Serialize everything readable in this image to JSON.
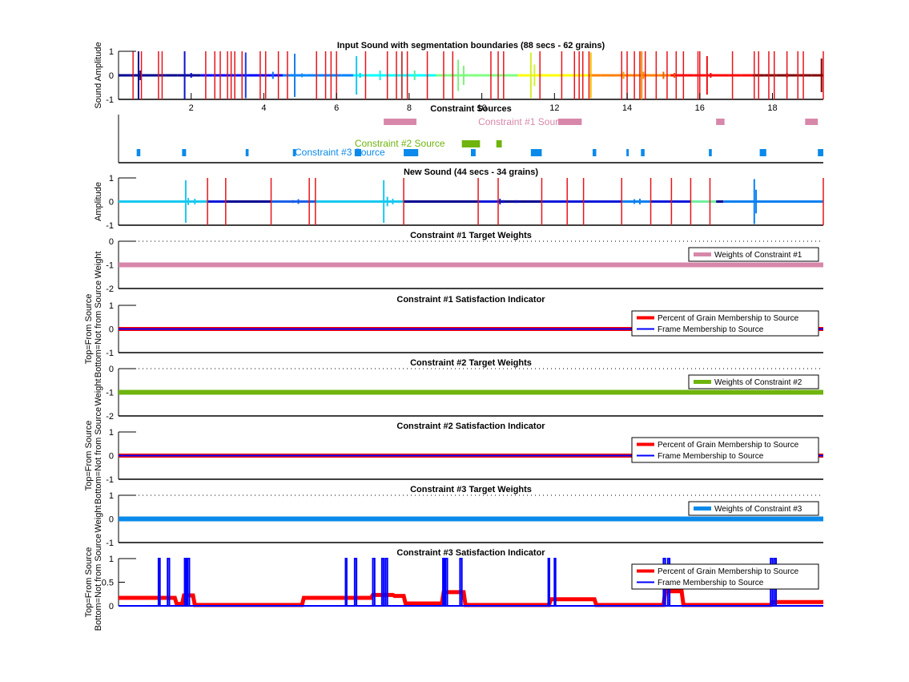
{
  "figure": {
    "background": "#ffffff"
  },
  "chart_data": [
    {
      "id": "input-sound",
      "type": "line",
      "title": "Input Sound with segmentation boundaries (88 secs - 62 grains)",
      "xlabel": "",
      "ylabel": "Sound Amplitude",
      "xlim": [
        0,
        19.4
      ],
      "ylim": [
        -1,
        1
      ],
      "xticks": [
        2,
        4,
        6,
        8,
        10,
        12,
        14,
        16,
        18
      ],
      "yticks": [
        -1,
        0,
        1
      ],
      "boundary_color": "#e8141b",
      "boundaries": [
        0.4,
        0.63,
        1.1,
        1.2,
        2.4,
        2.65,
        2.8,
        3.0,
        3.1,
        3.2,
        3.4,
        3.9,
        4.05,
        4.4,
        4.65,
        5.45,
        5.7,
        5.85,
        6.0,
        6.8,
        7.4,
        7.65,
        7.8,
        7.95,
        8.5,
        8.95,
        9.2,
        10.25,
        10.45,
        10.6,
        11.6,
        12.2,
        12.55,
        12.68,
        12.78,
        12.95,
        13.85,
        14.0,
        14.2,
        14.35,
        14.5,
        14.8,
        15.1,
        15.35,
        15.55,
        15.95,
        16.0,
        16.9,
        17.5,
        17.62,
        17.9,
        18.05,
        18.4,
        18.7,
        18.85,
        19.4
      ],
      "waveform_bursts": [
        {
          "x": 0.55,
          "amp": 1.0,
          "color": "#0a0a90"
        },
        {
          "x": 0.6,
          "amp": 0.2,
          "color": "#0a0a90"
        },
        {
          "x": 1.82,
          "amp": 1.0,
          "color": "#1010c8"
        },
        {
          "x": 2.0,
          "amp": 0.1,
          "color": "#1010c8"
        },
        {
          "x": 3.5,
          "amp": 0.95,
          "color": "#1a3ae0"
        },
        {
          "x": 4.25,
          "amp": 0.15,
          "color": "#1a70ee"
        },
        {
          "x": 4.85,
          "amp": 0.9,
          "color": "#1a80e8"
        },
        {
          "x": 5.05,
          "amp": 0.08,
          "color": "#1a90e8"
        },
        {
          "x": 6.55,
          "amp": 0.8,
          "color": "#18c8f0"
        },
        {
          "x": 6.65,
          "amp": 0.1,
          "color": "#18c8f0"
        },
        {
          "x": 7.2,
          "amp": 0.2,
          "color": "#20e8e8"
        },
        {
          "x": 7.8,
          "amp": 0.95,
          "color": "#30f0c8"
        },
        {
          "x": 8.15,
          "amp": 0.2,
          "color": "#50f0a0"
        },
        {
          "x": 9.35,
          "amp": 0.65,
          "color": "#80f080"
        },
        {
          "x": 9.5,
          "amp": 0.4,
          "color": "#80f080"
        },
        {
          "x": 11.35,
          "amp": 0.95,
          "color": "#d0f030"
        },
        {
          "x": 11.45,
          "amp": 0.45,
          "color": "#d8f030"
        },
        {
          "x": 13.0,
          "amp": 0.95,
          "color": "#f0c000"
        },
        {
          "x": 13.9,
          "amp": 0.15,
          "color": "#f0a000"
        },
        {
          "x": 14.4,
          "amp": 1.0,
          "color": "#f09000"
        },
        {
          "x": 14.45,
          "amp": 0.15,
          "color": "#f08000"
        },
        {
          "x": 15.0,
          "amp": 0.15,
          "color": "#f06000"
        },
        {
          "x": 15.3,
          "amp": 0.1,
          "color": "#f05000"
        },
        {
          "x": 16.2,
          "amp": 0.8,
          "color": "#e81010"
        },
        {
          "x": 16.3,
          "amp": 0.1,
          "color": "#e81010"
        },
        {
          "x": 18.4,
          "amp": 0.1,
          "color": "#b00808"
        },
        {
          "x": 19.35,
          "amp": 0.7,
          "color": "#800000"
        }
      ],
      "colormap": [
        "#00008f",
        "#0000ff",
        "#0080ff",
        "#00ffff",
        "#80ff80",
        "#ffff00",
        "#ff8000",
        "#ff0000",
        "#800000"
      ]
    },
    {
      "id": "constraint-sources",
      "type": "bar",
      "title": "Constraint Sources",
      "xlim": [
        0,
        19.4
      ],
      "ylim": [
        0,
        1
      ],
      "annotations": [
        {
          "text": "Constraint #1 Source",
          "x": 9.9,
          "row": 0,
          "color": "#d787aa"
        },
        {
          "text": "Constraint #2 Source",
          "x": 6.5,
          "row": 1,
          "color": "#6eb40c"
        },
        {
          "text": "Constraint #3 Source",
          "x": 4.85,
          "row": 2,
          "color": "#0a8aea"
        }
      ],
      "series": [
        {
          "name": "Constraint #1 Source",
          "color": "#d787aa",
          "row": 0,
          "intervals": [
            [
              7.3,
              8.2
            ],
            [
              12.1,
              12.75
            ],
            [
              16.45,
              16.68
            ],
            [
              18.9,
              19.25
            ]
          ]
        },
        {
          "name": "Constraint #2 Source",
          "color": "#6eb40c",
          "row": 1,
          "intervals": [
            [
              9.45,
              9.95
            ],
            [
              10.4,
              10.55
            ]
          ]
        },
        {
          "name": "Constraint #3 Source",
          "color": "#0a8aea",
          "row": 2,
          "intervals": [
            [
              0.5,
              0.6
            ],
            [
              1.75,
              1.86
            ],
            [
              3.5,
              3.58
            ],
            [
              4.8,
              4.88
            ],
            [
              6.5,
              6.68
            ],
            [
              7.85,
              8.25
            ],
            [
              9.7,
              9.83
            ],
            [
              11.35,
              11.65
            ],
            [
              13.05,
              13.15
            ],
            [
              13.98,
              14.02
            ],
            [
              14.38,
              14.48
            ],
            [
              16.25,
              16.33
            ],
            [
              17.65,
              17.83
            ],
            [
              19.25,
              19.4
            ]
          ]
        }
      ]
    },
    {
      "id": "new-sound",
      "type": "line",
      "title": "New Sound (44 secs - 34 grains)",
      "ylabel": "Amplitude",
      "xlim": [
        0,
        19.4
      ],
      "ylim": [
        -1,
        1
      ],
      "yticks": [
        -1,
        0,
        1
      ],
      "boundary_color": "#e8141b",
      "boundaries": [
        2.45,
        2.95,
        4.2,
        5.25,
        5.42,
        7.85,
        9.9,
        10.45,
        11.65,
        12.35,
        12.8,
        13.85,
        14.65,
        15.22,
        15.75,
        16.28,
        19.4
      ],
      "segments": [
        {
          "x0": 0,
          "x1": 2.45,
          "color": "#18c8f0"
        },
        {
          "x0": 2.45,
          "x1": 2.95,
          "color": "#0a18d8"
        },
        {
          "x0": 2.95,
          "x1": 4.2,
          "color": "#000090"
        },
        {
          "x0": 4.2,
          "x1": 5.42,
          "color": "#1a60e8"
        },
        {
          "x0": 5.42,
          "x1": 7.85,
          "color": "#18c8f0"
        },
        {
          "x0": 7.85,
          "x1": 9.9,
          "color": "#000090"
        },
        {
          "x0": 9.9,
          "x1": 10.45,
          "color": "#0a18d8"
        },
        {
          "x0": 10.45,
          "x1": 11.65,
          "color": "#000090"
        },
        {
          "x0": 11.65,
          "x1": 13.85,
          "color": "#0a18d8"
        },
        {
          "x0": 13.85,
          "x1": 14.65,
          "color": "#0a80f0"
        },
        {
          "x0": 14.65,
          "x1": 15.75,
          "color": "#0a18d8"
        },
        {
          "x0": 15.75,
          "x1": 16.45,
          "color": "#70f0a0"
        },
        {
          "x0": 16.45,
          "x1": 16.65,
          "color": "#000090"
        },
        {
          "x0": 16.65,
          "x1": 19.4,
          "color": "#0a80f0"
        }
      ],
      "waveform_bursts": [
        {
          "x": 0.85,
          "amp": 0.05,
          "color": "#18c8f0"
        },
        {
          "x": 1.85,
          "amp": 0.9,
          "color": "#18c8f0"
        },
        {
          "x": 1.92,
          "amp": 0.15,
          "color": "#18c8f0"
        },
        {
          "x": 2.1,
          "amp": 0.12,
          "color": "#18c8f0"
        },
        {
          "x": 4.8,
          "amp": 0.06,
          "color": "#1a60e8"
        },
        {
          "x": 4.95,
          "amp": 0.1,
          "color": "#1a60e8"
        },
        {
          "x": 6.3,
          "amp": 0.05,
          "color": "#18c8f0"
        },
        {
          "x": 7.3,
          "amp": 0.9,
          "color": "#18c8f0"
        },
        {
          "x": 7.4,
          "amp": 0.2,
          "color": "#18c8f0"
        },
        {
          "x": 7.55,
          "amp": 0.12,
          "color": "#18c8f0"
        },
        {
          "x": 10.5,
          "amp": 0.12,
          "color": "#0a18d8"
        },
        {
          "x": 10.6,
          "amp": 0.06,
          "color": "#0a18d8"
        },
        {
          "x": 10.95,
          "amp": 0.06,
          "color": "#0a18d8"
        },
        {
          "x": 14.2,
          "amp": 0.1,
          "color": "#0a80f0"
        },
        {
          "x": 14.35,
          "amp": 0.12,
          "color": "#0a80f0"
        },
        {
          "x": 17.5,
          "amp": 0.95,
          "color": "#0a80f0"
        },
        {
          "x": 17.55,
          "amp": 0.5,
          "color": "#0a80f0"
        },
        {
          "x": 18.05,
          "amp": 0.05,
          "color": "#0a80f0"
        }
      ]
    },
    {
      "id": "c1-target",
      "type": "line",
      "title": "Constraint #1 Target Weights",
      "ylabel": "Weight",
      "xlim": [
        0,
        19.4
      ],
      "ylim": [
        -2,
        0
      ],
      "yticks": [
        -2,
        -1,
        0
      ],
      "dotted_top": true,
      "series": [
        {
          "name": "Weights of Constraint #1",
          "color": "#d787aa",
          "value": -1
        }
      ],
      "legend": "top-right"
    },
    {
      "id": "c1-satisfaction",
      "type": "line",
      "title": "Constraint #1 Satisfaction Indicator",
      "ylabel": "Top=From Source\nBottom=Not from Source",
      "xlim": [
        0,
        19.4
      ],
      "ylim": [
        -1,
        1
      ],
      "yticks": [
        -1,
        0,
        1
      ],
      "series": [
        {
          "name": "Percent of Grain Membership to Source",
          "color": "#ff0000",
          "constant": 0
        },
        {
          "name": "Frame Membership to Source",
          "color": "#0000ff",
          "constant": 0
        }
      ],
      "legend": "top-right"
    },
    {
      "id": "c2-target",
      "type": "line",
      "title": "Constraint #2 Target Weights",
      "ylabel": "Weight",
      "xlim": [
        0,
        19.4
      ],
      "ylim": [
        -2,
        0
      ],
      "yticks": [
        -2,
        -1,
        0
      ],
      "dotted_top": true,
      "series": [
        {
          "name": "Weights of Constraint #2",
          "color": "#6eb40c",
          "value": -1
        }
      ],
      "legend": "top-right"
    },
    {
      "id": "c2-satisfaction",
      "type": "line",
      "title": "Constraint #2 Satisfaction Indicator",
      "ylabel": "Top=From Source\nBottom=Not from Source",
      "xlim": [
        0,
        19.4
      ],
      "ylim": [
        -1,
        1
      ],
      "yticks": [
        -1,
        0,
        1
      ],
      "series": [
        {
          "name": "Percent of Grain Membership to Source",
          "color": "#ff0000",
          "constant": 0
        },
        {
          "name": "Frame Membership to Source",
          "color": "#0000ff",
          "constant": 0
        }
      ],
      "legend": "top-right"
    },
    {
      "id": "c3-target",
      "type": "line",
      "title": "Constraint #3 Target Weights",
      "ylabel": "Weight",
      "xlim": [
        0,
        19.4
      ],
      "ylim": [
        -1,
        1
      ],
      "yticks": [
        -1,
        0,
        1
      ],
      "dotted_top": true,
      "series": [
        {
          "name": "Weights of Constraint #3",
          "color": "#0a8aea",
          "value": 0
        }
      ],
      "legend": "top-right"
    },
    {
      "id": "c3-satisfaction",
      "type": "line",
      "title": "Constraint #3 Satisfaction Indicator",
      "ylabel": "Top=From Source\nBottom=Not from Source",
      "xlim": [
        0,
        19.4
      ],
      "ylim": [
        0,
        1
      ],
      "yticks": [
        0,
        0.5,
        1
      ],
      "series": [
        {
          "name": "Percent of Grain Membership to Source",
          "color": "#ff0000",
          "steps": [
            [
              0,
              0.17
            ],
            [
              1.55,
              0.17
            ],
            [
              1.6,
              0.04
            ],
            [
              1.75,
              0.04
            ],
            [
              1.8,
              0.22
            ],
            [
              2.05,
              0.22
            ],
            [
              2.1,
              0.02
            ],
            [
              5.05,
              0.02
            ],
            [
              5.1,
              0.17
            ],
            [
              6.95,
              0.17
            ],
            [
              7.0,
              0.23
            ],
            [
              7.55,
              0.23
            ],
            [
              7.6,
              0.21
            ],
            [
              7.85,
              0.21
            ],
            [
              7.9,
              0.05
            ],
            [
              8.9,
              0.05
            ],
            [
              8.95,
              0.29
            ],
            [
              9.5,
              0.29
            ],
            [
              9.55,
              0.02
            ],
            [
              11.85,
              0.02
            ],
            [
              11.9,
              0.14
            ],
            [
              13.1,
              0.14
            ],
            [
              13.15,
              0.02
            ],
            [
              15.0,
              0.02
            ],
            [
              15.05,
              0.31
            ],
            [
              15.5,
              0.31
            ],
            [
              15.55,
              0.02
            ],
            [
              17.95,
              0.02
            ],
            [
              18.0,
              0.08
            ],
            [
              19.4,
              0.08
            ]
          ]
        },
        {
          "name": "Frame Membership to Source",
          "color": "#0000ff",
          "pulses": [
            [
              1.1,
              1.14
            ],
            [
              1.35,
              1.4
            ],
            [
              1.82,
              1.86
            ],
            [
              1.9,
              1.95
            ],
            [
              6.25,
              6.28
            ],
            [
              6.5,
              6.55
            ],
            [
              7.0,
              7.05
            ],
            [
              7.25,
              7.3
            ],
            [
              7.35,
              7.4
            ],
            [
              8.93,
              8.97
            ],
            [
              9.0,
              9.05
            ],
            [
              9.4,
              9.45
            ],
            [
              11.83,
              11.86
            ],
            [
              12.0,
              12.03
            ],
            [
              15.0,
              15.05
            ],
            [
              15.12,
              15.17
            ],
            [
              17.95,
              18.0
            ],
            [
              18.05,
              18.1
            ]
          ]
        }
      ],
      "legend": "top-right"
    }
  ]
}
